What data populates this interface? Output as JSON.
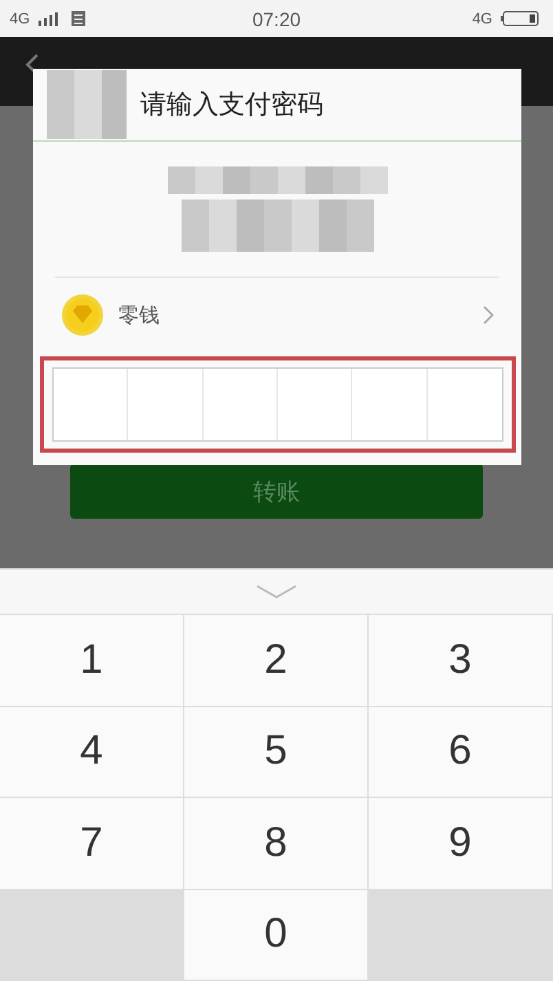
{
  "status_bar": {
    "network_left": "4G",
    "time": "07:20",
    "network_right": "4G"
  },
  "transfer_button": "转账",
  "dialog": {
    "title": "请输入支付密码",
    "payment_method": "零钱",
    "pin_slots": [
      {
        "filled": false
      },
      {
        "filled": false
      },
      {
        "filled": false
      },
      {
        "filled": false
      },
      {
        "filled": false
      },
      {
        "filled": false
      }
    ]
  },
  "keypad": {
    "keys": [
      {
        "kind": "digit",
        "label": "1"
      },
      {
        "kind": "digit",
        "label": "2"
      },
      {
        "kind": "digit",
        "label": "3"
      },
      {
        "kind": "digit",
        "label": "4"
      },
      {
        "kind": "digit",
        "label": "5"
      },
      {
        "kind": "digit",
        "label": "6"
      },
      {
        "kind": "digit",
        "label": "7"
      },
      {
        "kind": "digit",
        "label": "8"
      },
      {
        "kind": "digit",
        "label": "9"
      },
      {
        "kind": "blank"
      },
      {
        "kind": "digit",
        "label": "0"
      },
      {
        "kind": "blank"
      }
    ]
  }
}
